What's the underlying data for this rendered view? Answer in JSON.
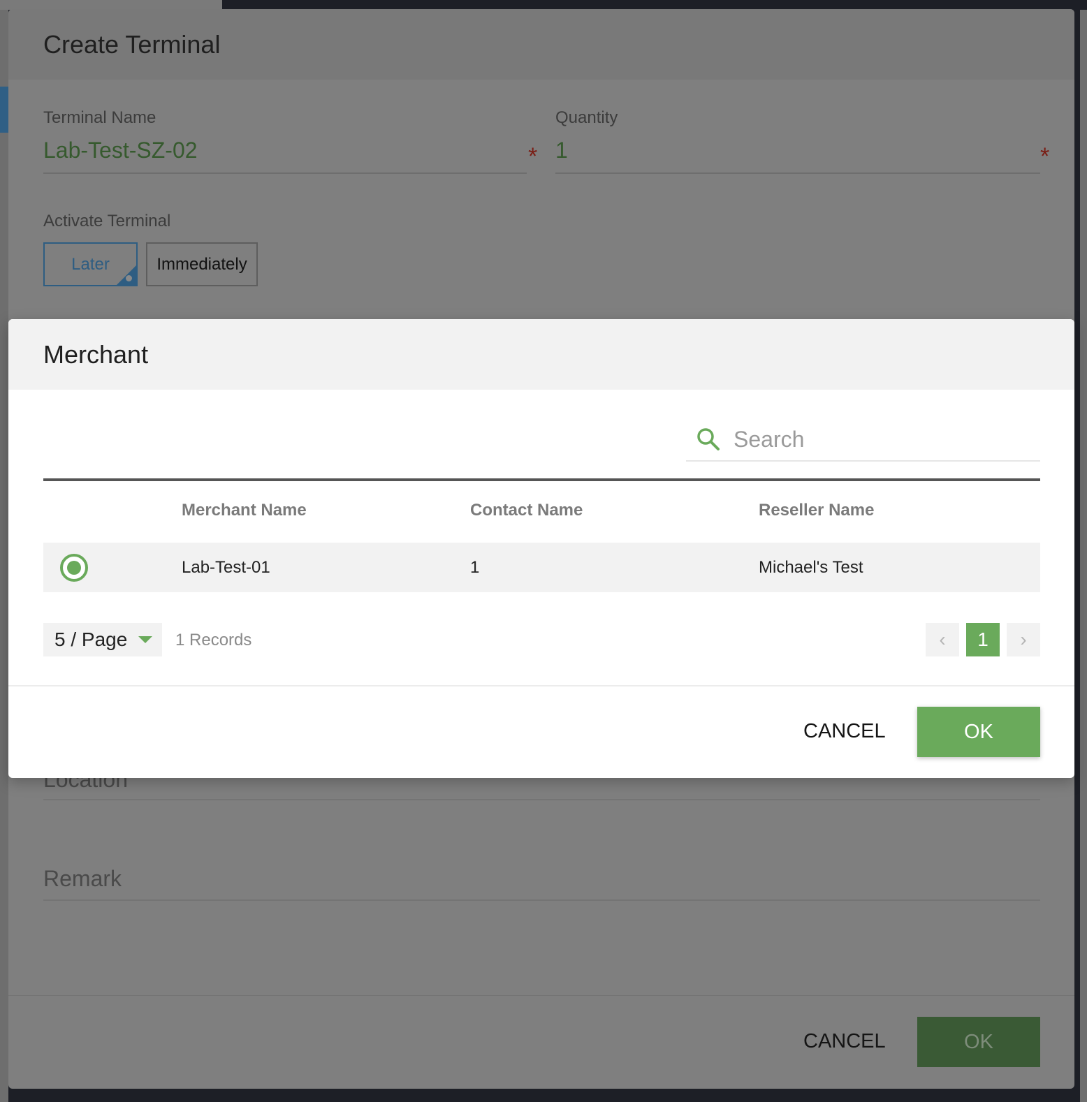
{
  "outer_dialog": {
    "title": "Create Terminal",
    "terminal_name": {
      "label": "Terminal Name",
      "value": "Lab-Test-SZ-02",
      "required_mark": "*"
    },
    "quantity": {
      "label": "Quantity",
      "value": "1",
      "required_mark": "*"
    },
    "activate": {
      "label": "Activate Terminal",
      "options": [
        "Later",
        "Immediately"
      ],
      "selected": "Later"
    },
    "location_label": "Location",
    "remark_label": "Remark",
    "cancel_label": "CANCEL",
    "ok_label": "OK"
  },
  "merchant_dialog": {
    "title": "Merchant",
    "search": {
      "placeholder": "Search",
      "value": ""
    },
    "columns": [
      "Merchant Name",
      "Contact Name",
      "Reseller Name"
    ],
    "rows": [
      {
        "merchant_name": "Lab-Test-01",
        "contact_name": "1",
        "reseller_name": "Michael's Test",
        "selected": true
      }
    ],
    "page_size": "5 / Page",
    "records": "1 Records",
    "pagination": {
      "prev": "‹",
      "current": "1",
      "next": "›"
    },
    "cancel_label": "CANCEL",
    "ok_label": "OK"
  },
  "colors": {
    "accent_green": "#6aaa5b",
    "selected_blue": "#2e5d82",
    "required_red": "#7a1d14"
  },
  "icons": {
    "search": "search-icon",
    "radio": "radio-selected-icon",
    "caret": "caret-down-icon",
    "prev": "chevron-left-icon",
    "next": "chevron-right-icon"
  }
}
